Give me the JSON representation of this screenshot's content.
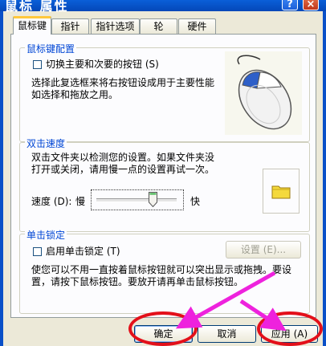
{
  "window": {
    "title": "鼠标 属性",
    "help_glyph": "?",
    "close_glyph": "×"
  },
  "tabs": [
    {
      "label": "鼠标键",
      "active": true
    },
    {
      "label": "指针"
    },
    {
      "label": "指针选项"
    },
    {
      "label": "轮"
    },
    {
      "label": "硬件"
    }
  ],
  "button_config": {
    "title": "鼠标键配置",
    "checkbox_label": "切换主要和次要的按钮 (S)",
    "checked": false,
    "desc_line1": "选择此复选框来将右按钮设成用于主要性能",
    "desc_line2": "如选择和拖放之用。"
  },
  "double_click": {
    "title": "双击速度",
    "desc_line1": "双击文件夹以检测您的设置。如果文件夹没",
    "desc_line2": "打开或关闭，请用慢一点的设置再试一次。",
    "speed_label": "速度 (D):",
    "slow_label": "慢",
    "fast_label": "快",
    "speed_level": 0.7
  },
  "click_lock": {
    "title": "单击锁定",
    "checkbox_label": "启用单击锁定 (T)",
    "checked": false,
    "settings_button": "设置 (E)...",
    "desc_line1": "使您可以不用一直按着鼠标按钮就可以突出显示或拖拽。要设",
    "desc_line2": "置，请按下鼠标按钮。要放开请再单击鼠标按钮。"
  },
  "footer": {
    "ok": "确定",
    "cancel": "取消",
    "apply": "应用 (A)"
  },
  "colors": {
    "annotation_ring": "#e3101a",
    "annotation_arrow": "#ee22dd",
    "group_title": "#0046d5"
  }
}
